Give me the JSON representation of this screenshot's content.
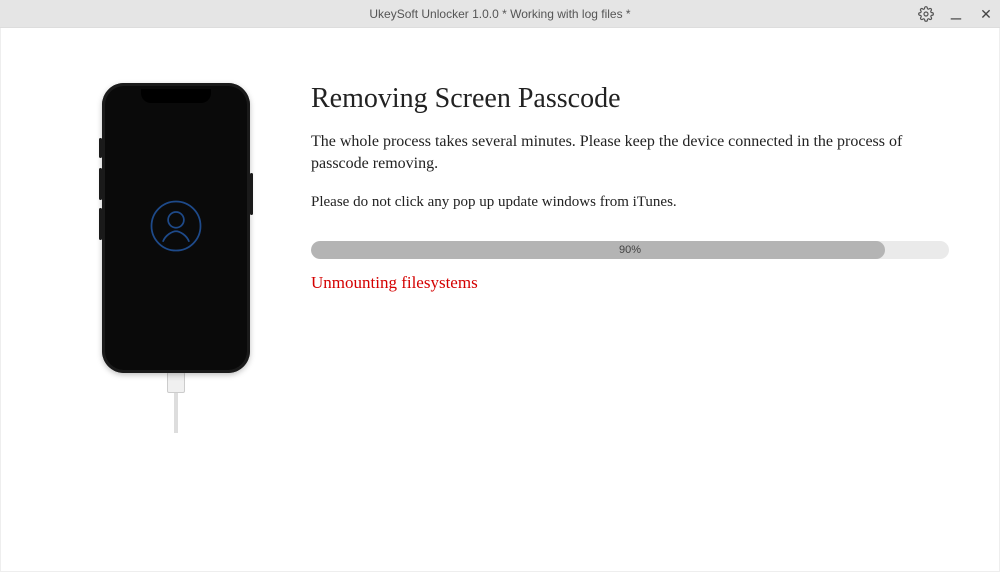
{
  "titlebar": {
    "title": "UkeySoft Unlocker 1.0.0 * Working with log files *"
  },
  "main": {
    "heading": "Removing Screen Passcode",
    "description": "The whole process takes several minutes. Please keep the device connected in the process of passcode removing.",
    "warning": "Please do not click any pop up update windows from iTunes.",
    "progress_percent": 90,
    "progress_label": "90%",
    "status": "Unmounting filesystems"
  },
  "colors": {
    "status_red": "#d40000",
    "progress_fill": "#b4b4b4",
    "accent_blue": "#1e4a8a"
  }
}
